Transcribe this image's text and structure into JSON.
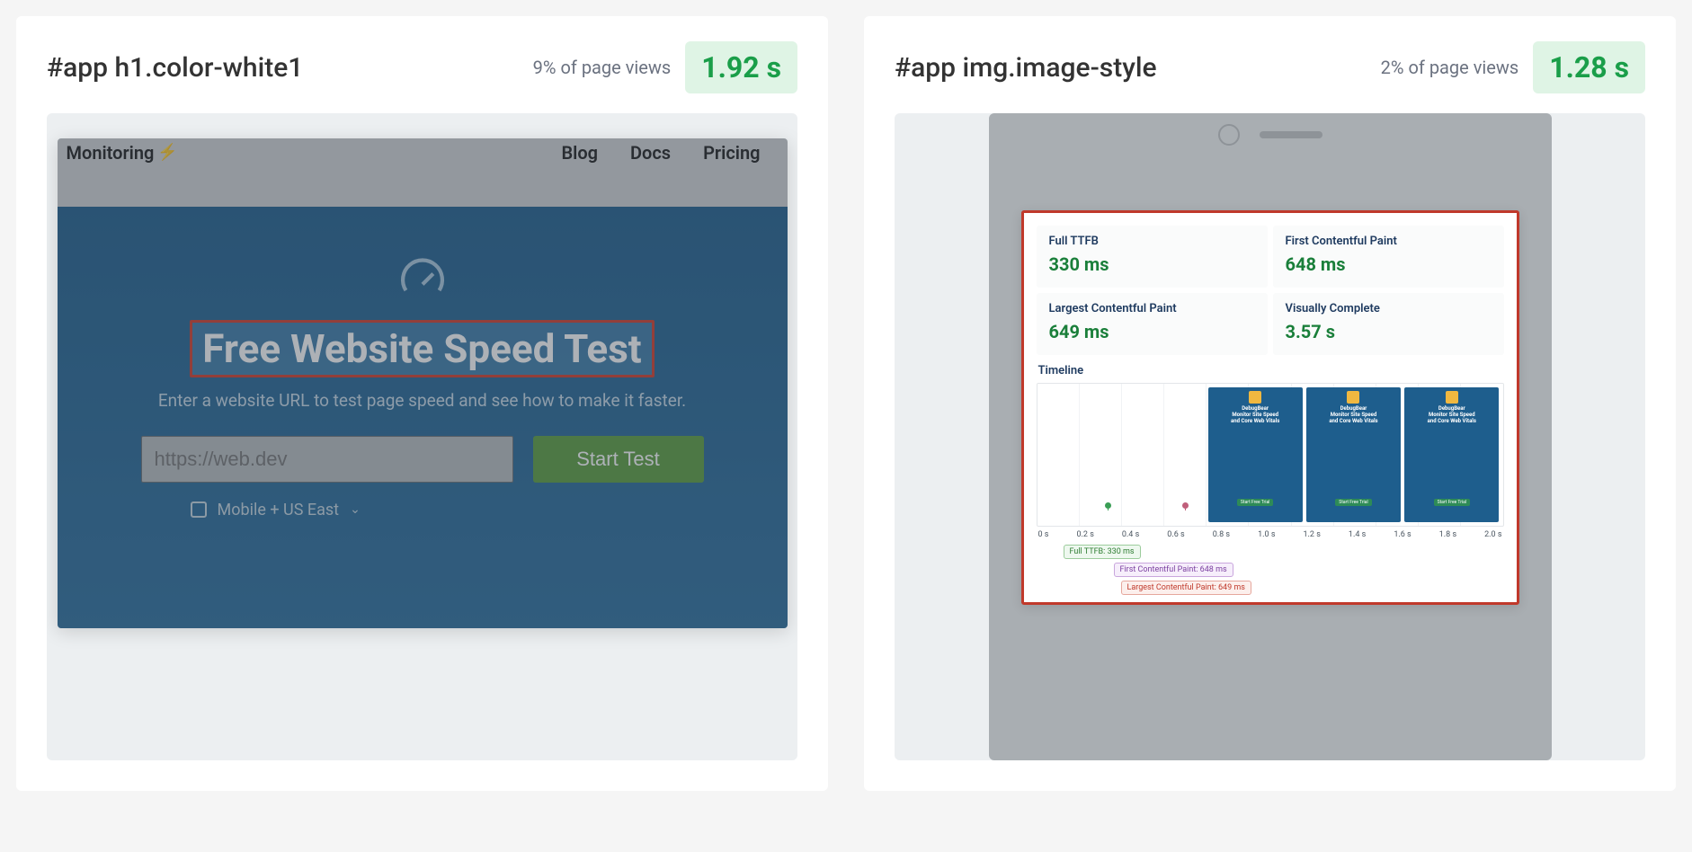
{
  "cards": [
    {
      "selector": "#app h1.color-white1",
      "percent_label": "9% of page views",
      "metric": "1.92 s",
      "mock": {
        "nav_left": "Monitoring",
        "nav_bolt": "⚡",
        "nav_items": [
          "Blog",
          "Docs",
          "Pricing"
        ],
        "hero_title": "Free Website Speed Test",
        "hero_sub": "Enter a website URL to test page speed and see how to make it faster.",
        "input_placeholder": "https://web.dev",
        "button_label": "Start Test",
        "options_label": "Mobile + US East"
      }
    },
    {
      "selector": "#app img.image-style",
      "percent_label": "2% of page views",
      "metric": "1.28 s",
      "mock": {
        "tiles": [
          {
            "label": "Full TTFB",
            "value": "330 ms"
          },
          {
            "label": "First Contentful Paint",
            "value": "648 ms"
          },
          {
            "label": "Largest Contentful Paint",
            "value": "649 ms"
          },
          {
            "label": "Visually Complete",
            "value": "3.57 s"
          }
        ],
        "timeline_label": "Timeline",
        "thumb_brand": "DebugBear",
        "thumb_line1": "Monitor Site Speed",
        "thumb_line2": "and Core Web Vitals",
        "thumb_cta": "Start Free Trial",
        "ticks": [
          "0 s",
          "0.2 s",
          "0.4 s",
          "0.6 s",
          "0.8 s",
          "1.0 s",
          "1.2 s",
          "1.4 s",
          "1.6 s",
          "1.8 s",
          "2.0 s"
        ],
        "markers": {
          "ttfb": "Full TTFB: 330 ms",
          "fcp": "First Contentful Paint: 648 ms",
          "lcp": "Largest Contentful Paint: 649 ms"
        }
      }
    }
  ]
}
